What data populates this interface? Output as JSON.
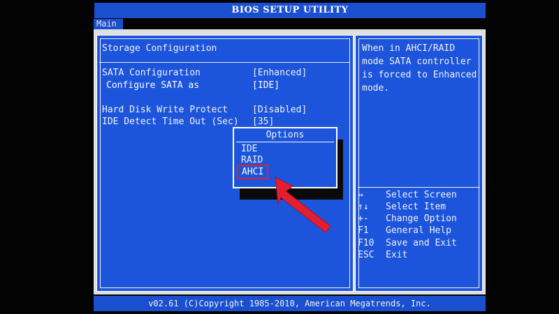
{
  "window": {
    "title": "BIOS SETUP UTILITY"
  },
  "tabs": [
    {
      "label": "Main"
    }
  ],
  "main": {
    "section_title": "Storage Configuration",
    "settings": [
      {
        "label": "SATA Configuration",
        "value": "[Enhanced]"
      },
      {
        "label": "Configure SATA as",
        "value": "[IDE]"
      },
      {
        "label": "Hard Disk Write Protect",
        "value": "[Disabled]"
      },
      {
        "label": "IDE Detect Time Out (Sec)",
        "value": "[35]"
      }
    ]
  },
  "popup": {
    "title": "Options",
    "options": [
      "IDE",
      "RAID",
      "AHCI"
    ],
    "highlighted": "AHCI"
  },
  "help": {
    "text": "When in AHCI/RAID mode SATA controller is forced to Enhanced mode.",
    "keys": [
      {
        "key": "↔",
        "action": "Select Screen"
      },
      {
        "key": "↑↓",
        "action": "Select Item"
      },
      {
        "key": "+-",
        "action": "Change Option"
      },
      {
        "key": "F1",
        "action": "General Help"
      },
      {
        "key": "F10",
        "action": "Save and Exit"
      },
      {
        "key": "ESC",
        "action": "Exit"
      }
    ]
  },
  "footer": {
    "copyright": "v02.61 (C)Copyright 1985-2010, American Megatrends, Inc."
  },
  "colors": {
    "bios_blue": "#1c55dc",
    "bar_blue": "#1a4fd0",
    "highlight_red": "#e02030",
    "text": "#f2f2f2"
  }
}
